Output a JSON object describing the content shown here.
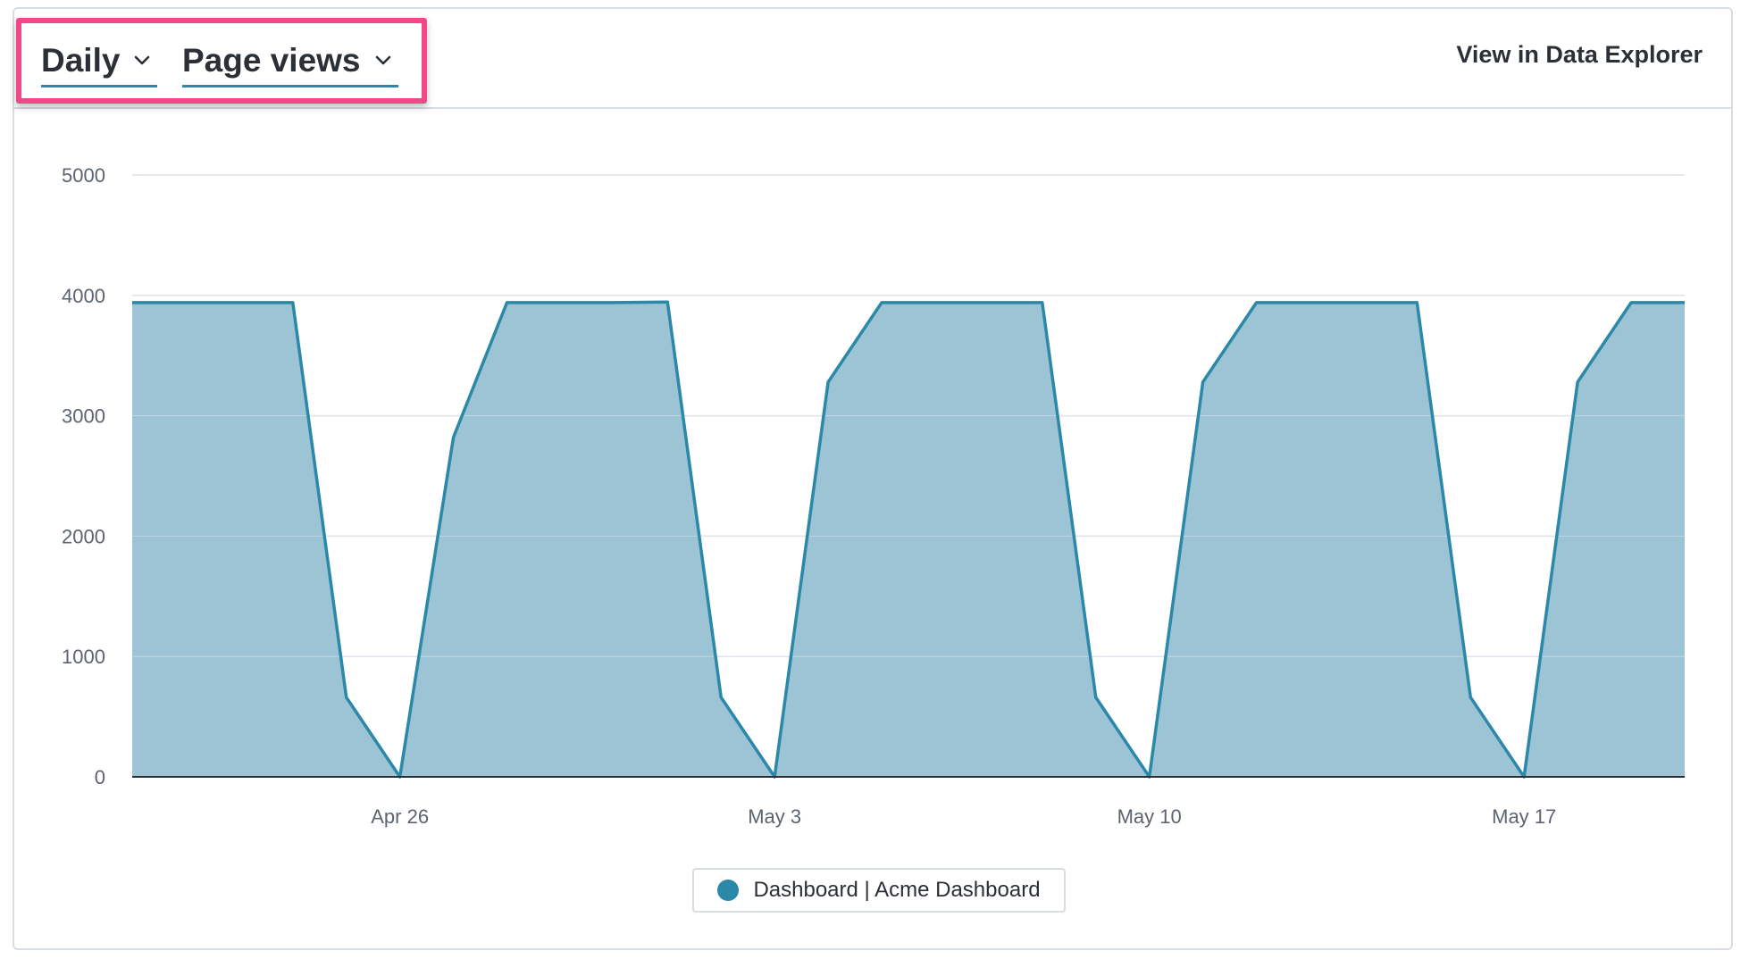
{
  "header": {
    "interval_label": "Daily",
    "metric_label": "Page views",
    "explorer_link": "View in Data Explorer"
  },
  "colors": {
    "highlight": "#f2488a",
    "series_line": "#2b88a8",
    "series_fill": "#9cc4d5",
    "accent_underline": "#2b88a8"
  },
  "icons": {
    "interval_chevron": "chevron-down-icon",
    "metric_chevron": "chevron-down-icon"
  },
  "chart_data": {
    "type": "area",
    "title": "",
    "xlabel": "",
    "ylabel": "",
    "ylim": [
      0,
      5000
    ],
    "yticks": [
      0,
      1000,
      2000,
      3000,
      4000,
      5000
    ],
    "xticks": [
      {
        "label": "Apr 26",
        "index": 5
      },
      {
        "label": "May 3",
        "index": 12
      },
      {
        "label": "May 10",
        "index": 19
      },
      {
        "label": "May 17",
        "index": 26
      }
    ],
    "grid": true,
    "legend_position": "bottom-center",
    "series": [
      {
        "name": "Dashboard | Acme Dashboard",
        "x": [
          "Apr 21",
          "Apr 22",
          "Apr 23",
          "Apr 24",
          "Apr 25",
          "Apr 26",
          "Apr 27",
          "Apr 28",
          "Apr 29",
          "Apr 30",
          "May 1",
          "May 2",
          "May 3",
          "May 4",
          "May 5",
          "May 6",
          "May 7",
          "May 8",
          "May 9",
          "May 10",
          "May 11",
          "May 12",
          "May 13",
          "May 14",
          "May 15",
          "May 16",
          "May 17",
          "May 18",
          "May 19",
          "May 20"
        ],
        "values": [
          3940,
          3940,
          3940,
          3940,
          660,
          0,
          2820,
          3940,
          3940,
          3940,
          3945,
          660,
          0,
          3280,
          3940,
          3940,
          3940,
          3940,
          660,
          0,
          3280,
          3940,
          3940,
          3940,
          3940,
          660,
          0,
          3280,
          3940,
          3940
        ]
      }
    ]
  }
}
